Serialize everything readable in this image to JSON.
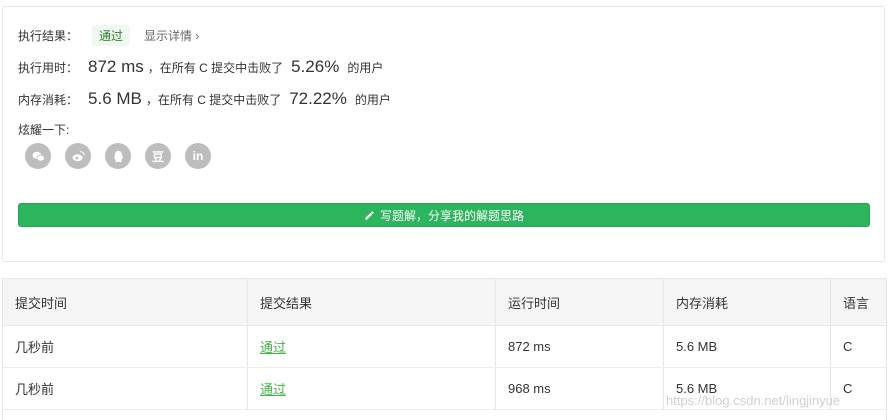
{
  "result": {
    "exec_label": "执行结果：",
    "status": "通过",
    "detail_link": "显示详情 ›",
    "time_label": "执行用时：",
    "time_value": "872 ms",
    "time_mid": "，在所有 C 提交中击败了",
    "time_pct": "5.26%",
    "time_suffix": "的用户",
    "mem_label": "内存消耗：",
    "mem_value": "5.6 MB",
    "mem_mid": "，在所有 C 提交中击败了",
    "mem_pct": "72.22%",
    "mem_suffix": "的用户",
    "share_label": "炫耀一下:",
    "share_icons": [
      "wechat-icon",
      "weibo-icon",
      "qq-icon",
      "douban-icon",
      "linkedin-icon"
    ],
    "douban_glyph": "豆",
    "linkedin_glyph": "in",
    "write_button": "写题解，分享我的解题思路"
  },
  "table": {
    "headers": [
      "提交时间",
      "提交结果",
      "运行时间",
      "内存消耗",
      "语言"
    ],
    "rows": [
      [
        "几秒前",
        "通过",
        "872 ms",
        "5.6 MB",
        "C"
      ],
      [
        "几秒前",
        "通过",
        "968 ms",
        "5.6 MB",
        "C"
      ]
    ]
  },
  "watermark": "https://blog.csdn.net/lingjinyue",
  "colors": {
    "accent": "#2db55d",
    "pass": "#44b549",
    "icon_bg": "#bdbdbd"
  }
}
